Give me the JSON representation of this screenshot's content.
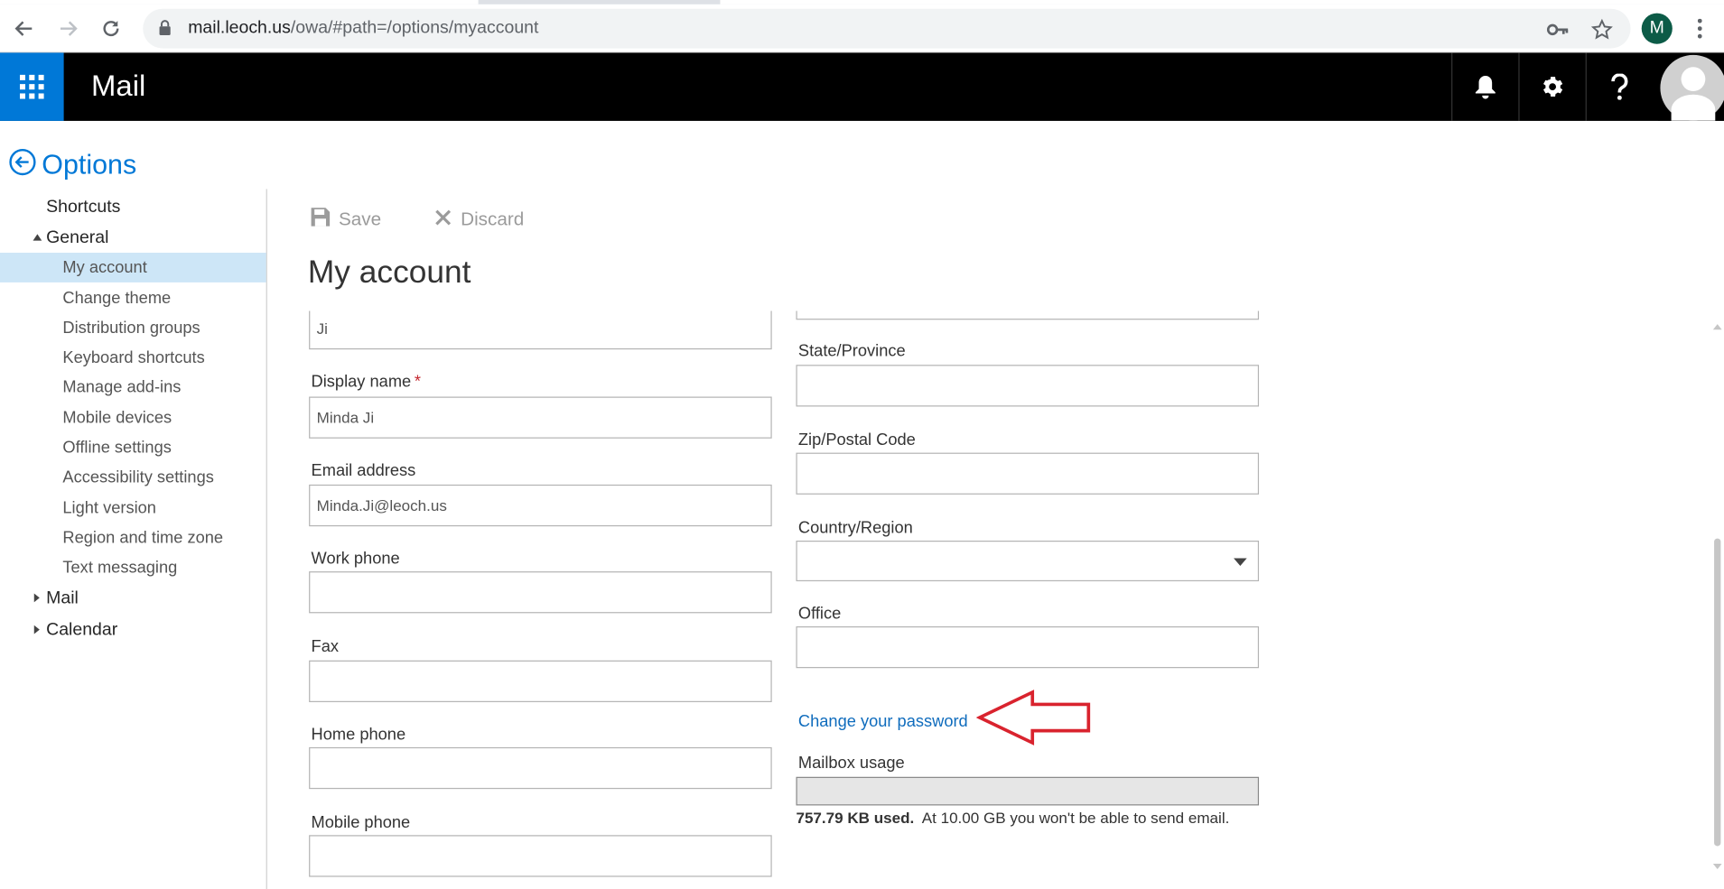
{
  "browser": {
    "url_host": "mail.leoch.us",
    "url_path": "/owa/#path=/options/myaccount",
    "profile_initial": "M",
    "icons": [
      "back-icon",
      "forward-icon",
      "reload-icon",
      "lock-icon",
      "key-icon",
      "star-icon",
      "kebab-menu-icon"
    ]
  },
  "header": {
    "app_name": "Mail",
    "brand_color": "#0078d7",
    "icons": [
      "app-launcher-icon",
      "bell-icon",
      "gear-icon",
      "help-icon",
      "user-avatar-icon"
    ]
  },
  "options": {
    "title": "Options",
    "nav": {
      "shortcuts": "Shortcuts",
      "general": "General",
      "general_items": [
        "My account",
        "Change theme",
        "Distribution groups",
        "Keyboard shortcuts",
        "Manage add-ins",
        "Mobile devices",
        "Offline settings",
        "Accessibility settings",
        "Light version",
        "Region and time zone",
        "Text messaging"
      ],
      "selected": "My account",
      "mail": "Mail",
      "calendar": "Calendar"
    }
  },
  "toolbar": {
    "save_label": "Save",
    "discard_label": "Discard"
  },
  "page_title": "My account",
  "form": {
    "last_name_value": "Ji",
    "display_name_label": "Display name",
    "display_name_required": "*",
    "display_name_value": "Minda Ji",
    "email_label": "Email address",
    "email_value": "Minda.Ji@leoch.us",
    "work_phone_label": "Work phone",
    "work_phone_value": "",
    "fax_label": "Fax",
    "fax_value": "",
    "home_phone_label": "Home phone",
    "home_phone_value": "",
    "mobile_phone_label": "Mobile phone",
    "mobile_phone_value": "",
    "state_label": "State/Province",
    "state_value": "",
    "zip_label": "Zip/Postal Code",
    "zip_value": "",
    "country_label": "Country/Region",
    "country_value": "",
    "office_label": "Office",
    "office_value": "",
    "change_password_link": "Change your password",
    "annotation_arrow_color": "#d9232e",
    "mailbox_usage_label": "Mailbox usage",
    "mailbox_usage_fraction": 0.0001,
    "mailbox_used": "757.79 KB used.",
    "mailbox_limit_text": "At 10.00 GB you won't be able to send email."
  }
}
